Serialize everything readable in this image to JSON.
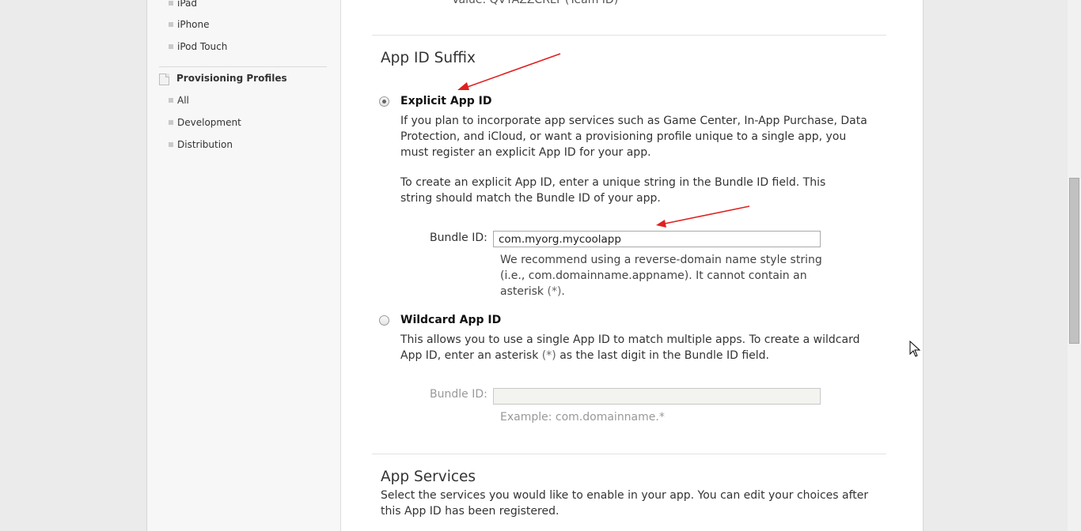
{
  "sidebar": {
    "device_items": [
      {
        "label": "iPad"
      },
      {
        "label": "iPhone"
      },
      {
        "label": "iPod Touch"
      }
    ],
    "provisioning": {
      "heading": "Provisioning Profiles",
      "items": [
        {
          "label": "All"
        },
        {
          "label": "Development"
        },
        {
          "label": "Distribution"
        }
      ]
    }
  },
  "main": {
    "cut_off_text": "Value: QVYAZZCRLY (Team ID)",
    "suffix_section": {
      "title": "App ID Suffix",
      "explicit": {
        "selected": true,
        "title": "Explicit App ID",
        "description": "If you plan to incorporate app services such as Game Center, In-App Purchase, Data Protection, and iCloud, or want a provisioning profile unique to a single app, you must register an explicit App ID for your app.",
        "instructions": "To create an explicit App ID, enter a unique string in the Bundle ID field. This string should match the Bundle ID of your app.",
        "bundle_label": "Bundle ID:",
        "bundle_value": "com.myorg.mycoolapp",
        "hint_text": "We recommend using a reverse-domain name style string (i.e., com.domainname.appname). It cannot contain an asterisk",
        "hint_asterisk": "(*)",
        "hint_end": "."
      },
      "wildcard": {
        "selected": false,
        "title": "Wildcard App ID",
        "description_start": "This allows you to use a single App ID to match multiple apps. To create a wildcard App ID, enter an asterisk",
        "description_asterisk": "(*)",
        "description_end": "as the last digit in the Bundle ID field.",
        "bundle_label": "Bundle ID:",
        "bundle_value": "",
        "example": "Example: com.domainname.*"
      }
    },
    "services_section": {
      "title": "App Services",
      "description": "Select the services you would like to enable in your app. You can edit your choices after this App ID has been registered."
    }
  },
  "annotation_color": "#e02020"
}
